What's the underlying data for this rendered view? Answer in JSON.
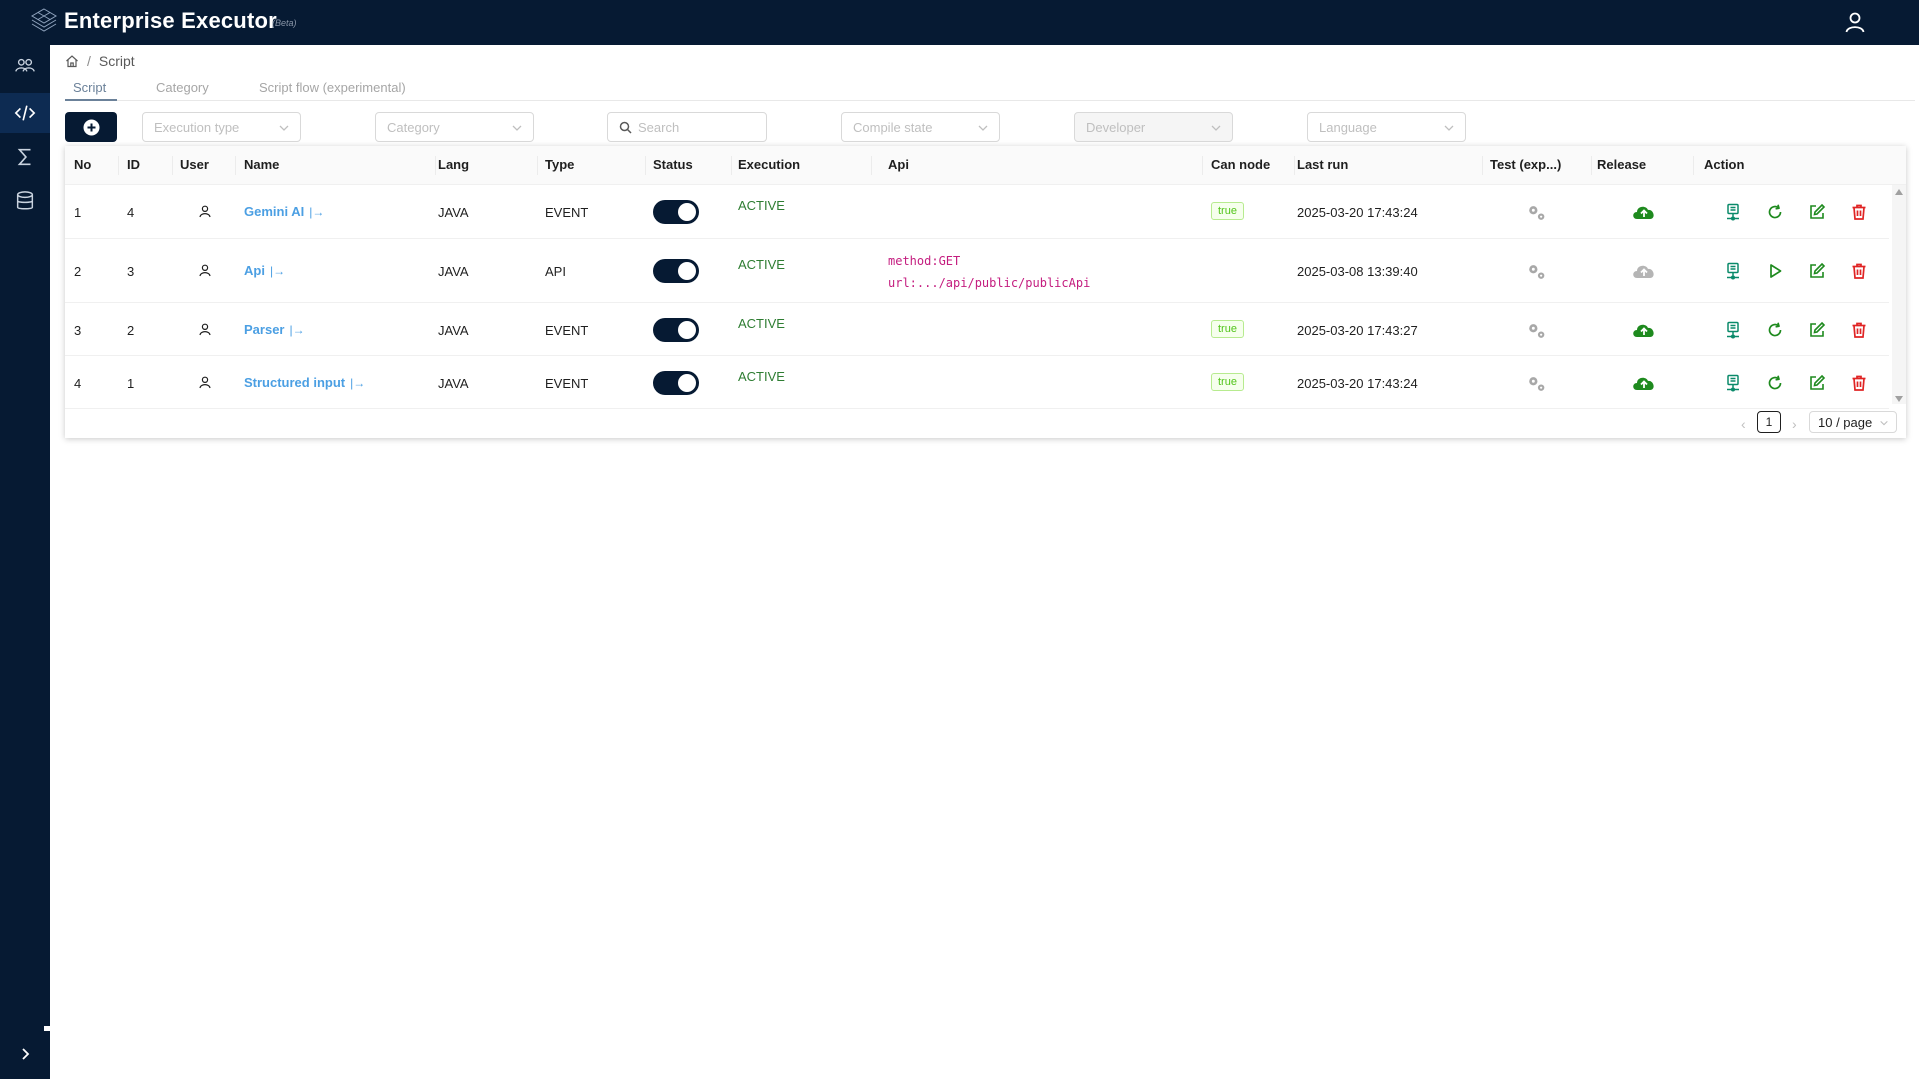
{
  "header": {
    "title": "Enterprise Executor",
    "badge": "(Beta)"
  },
  "sidebar": {
    "items": [
      {
        "name": "users-icon",
        "active": false
      },
      {
        "name": "code-icon",
        "active": true
      },
      {
        "name": "sigma-icon",
        "active": false
      },
      {
        "name": "database-icon",
        "active": false
      }
    ]
  },
  "breadcrumb": {
    "current": "Script"
  },
  "tabs": [
    {
      "label": "Script",
      "active": true
    },
    {
      "label": "Category",
      "active": false
    },
    {
      "label": "Script flow (experimental)",
      "active": false
    }
  ],
  "filters": {
    "execution_type": "Execution type",
    "category": "Category",
    "search": "Search",
    "compile_state": "Compile state",
    "developer": "Developer",
    "language": "Language"
  },
  "table": {
    "columns": [
      "No",
      "ID",
      "User",
      "Name",
      "Lang",
      "Type",
      "Status",
      "Execution",
      "Api",
      "Can node",
      "Last run",
      "Test (exp...)",
      "Release",
      "Action"
    ],
    "rows": [
      {
        "no": "1",
        "id": "4",
        "name": "Gemini AI",
        "lang": "JAVA",
        "type": "EVENT",
        "status_on": true,
        "execution": "ACTIVE",
        "api_method": "",
        "api_url": "",
        "can_node": "true",
        "last_run": "2025-03-20 17:43:24",
        "release": "released",
        "action": "reload"
      },
      {
        "no": "2",
        "id": "3",
        "name": "Api",
        "lang": "JAVA",
        "type": "API",
        "status_on": true,
        "execution": "ACTIVE",
        "api_method": "method:GET",
        "api_url": "url:.../api/public/publicApi",
        "can_node": "",
        "last_run": "2025-03-08 13:39:40",
        "release": "not-released",
        "action": "run"
      },
      {
        "no": "3",
        "id": "2",
        "name": "Parser",
        "lang": "JAVA",
        "type": "EVENT",
        "status_on": true,
        "execution": "ACTIVE",
        "api_method": "",
        "api_url": "",
        "can_node": "true",
        "last_run": "2025-03-20 17:43:27",
        "release": "released",
        "action": "reload"
      },
      {
        "no": "4",
        "id": "1",
        "name": "Structured input",
        "lang": "JAVA",
        "type": "EVENT",
        "status_on": true,
        "execution": "ACTIVE",
        "api_method": "",
        "api_url": "",
        "can_node": "true",
        "last_run": "2025-03-20 17:43:24",
        "release": "released",
        "action": "reload"
      }
    ]
  },
  "pagination": {
    "current": "1",
    "page_size": "10 / page"
  },
  "colors": {
    "navy": "#061a33",
    "link": "#4b9fe3",
    "green": "#1e8a1e",
    "red": "#e02424",
    "teal": "#0a8a6a"
  }
}
